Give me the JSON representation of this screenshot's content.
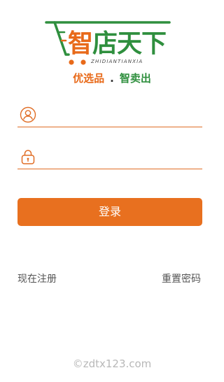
{
  "logo": {
    "chars": [
      "智",
      "店",
      "天",
      "下"
    ],
    "pinyin": "ZHIDIANTIANXIA",
    "icon": "shopping-cart-icon"
  },
  "slogan": {
    "part1": "优选品",
    "separator": ".",
    "part2": "智卖出"
  },
  "fields": {
    "username": {
      "icon": "user-icon",
      "placeholder": ""
    },
    "password": {
      "icon": "lock-icon",
      "placeholder": ""
    }
  },
  "login_button": "登录",
  "links": {
    "register": "现在注册",
    "reset_password": "重置密码"
  },
  "watermark": "©zdtx123.com",
  "colors": {
    "accent": "#e8701f",
    "brand_green": "#2f8f3e",
    "link_text": "#555555"
  }
}
